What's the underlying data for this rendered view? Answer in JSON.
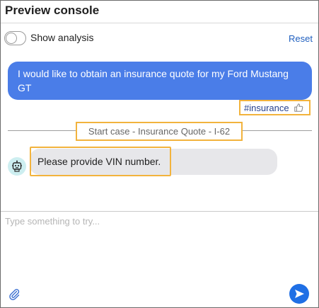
{
  "header": {
    "title": "Preview console"
  },
  "controls": {
    "show_analysis_label": "Show analysis",
    "show_analysis_on": false,
    "reset_label": "Reset"
  },
  "conversation": {
    "user_message": "I would like to obtain an insurance quote for my Ford Mustang GT",
    "intent_tag": "#insurance",
    "case_label": "Start case - Insurance Quote - I-62",
    "bot_message": "Please provide VIN number."
  },
  "composer": {
    "placeholder": "Type something to try..."
  },
  "icons": {
    "feedback": "thumbs-up-icon",
    "bot": "robot-icon",
    "attach": "paperclip-icon",
    "send": "send-arrow-icon"
  },
  "colors": {
    "user_bubble": "#4a7de8",
    "bot_bubble": "#e7e7ea",
    "highlight": "#f2b33d",
    "link": "#1f5fbf",
    "send": "#1f6fe5"
  }
}
